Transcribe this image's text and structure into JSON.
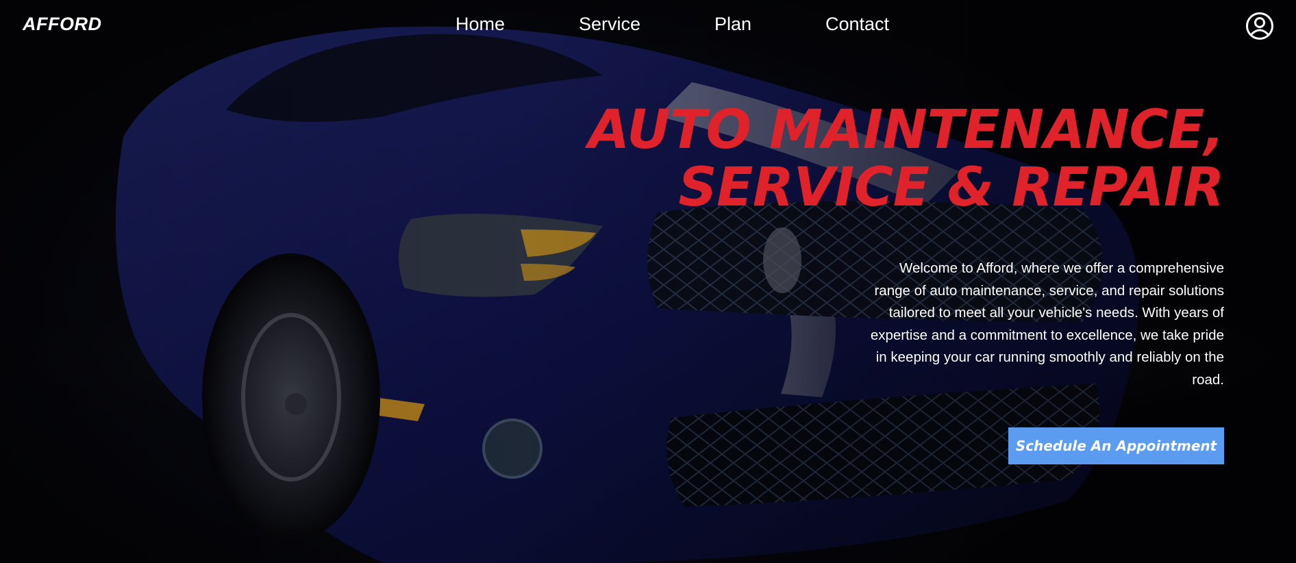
{
  "brand": {
    "logo_text": "AFFORD"
  },
  "nav": {
    "items": [
      {
        "label": "Home"
      },
      {
        "label": "Service"
      },
      {
        "label": "Plan"
      },
      {
        "label": "Contact"
      }
    ],
    "user_icon": "user-circle-icon"
  },
  "hero": {
    "headline_line1": "AUTO MAINTENANCE,",
    "headline_line2": "SERVICE & REPAIR",
    "intro": "Welcome to Afford, where we offer a comprehensive range of auto maintenance, service, and repair solutions tailored to meet all your vehicle's needs. With years of expertise and a commitment to excellence, we take pride in keeping your car running smoothly and reliably on the road.",
    "cta_label": "Schedule An Appointment"
  },
  "colors": {
    "headline": "#e0232a",
    "cta_background": "#5b9bf0",
    "text": "#ffffff",
    "background": "#050509"
  }
}
